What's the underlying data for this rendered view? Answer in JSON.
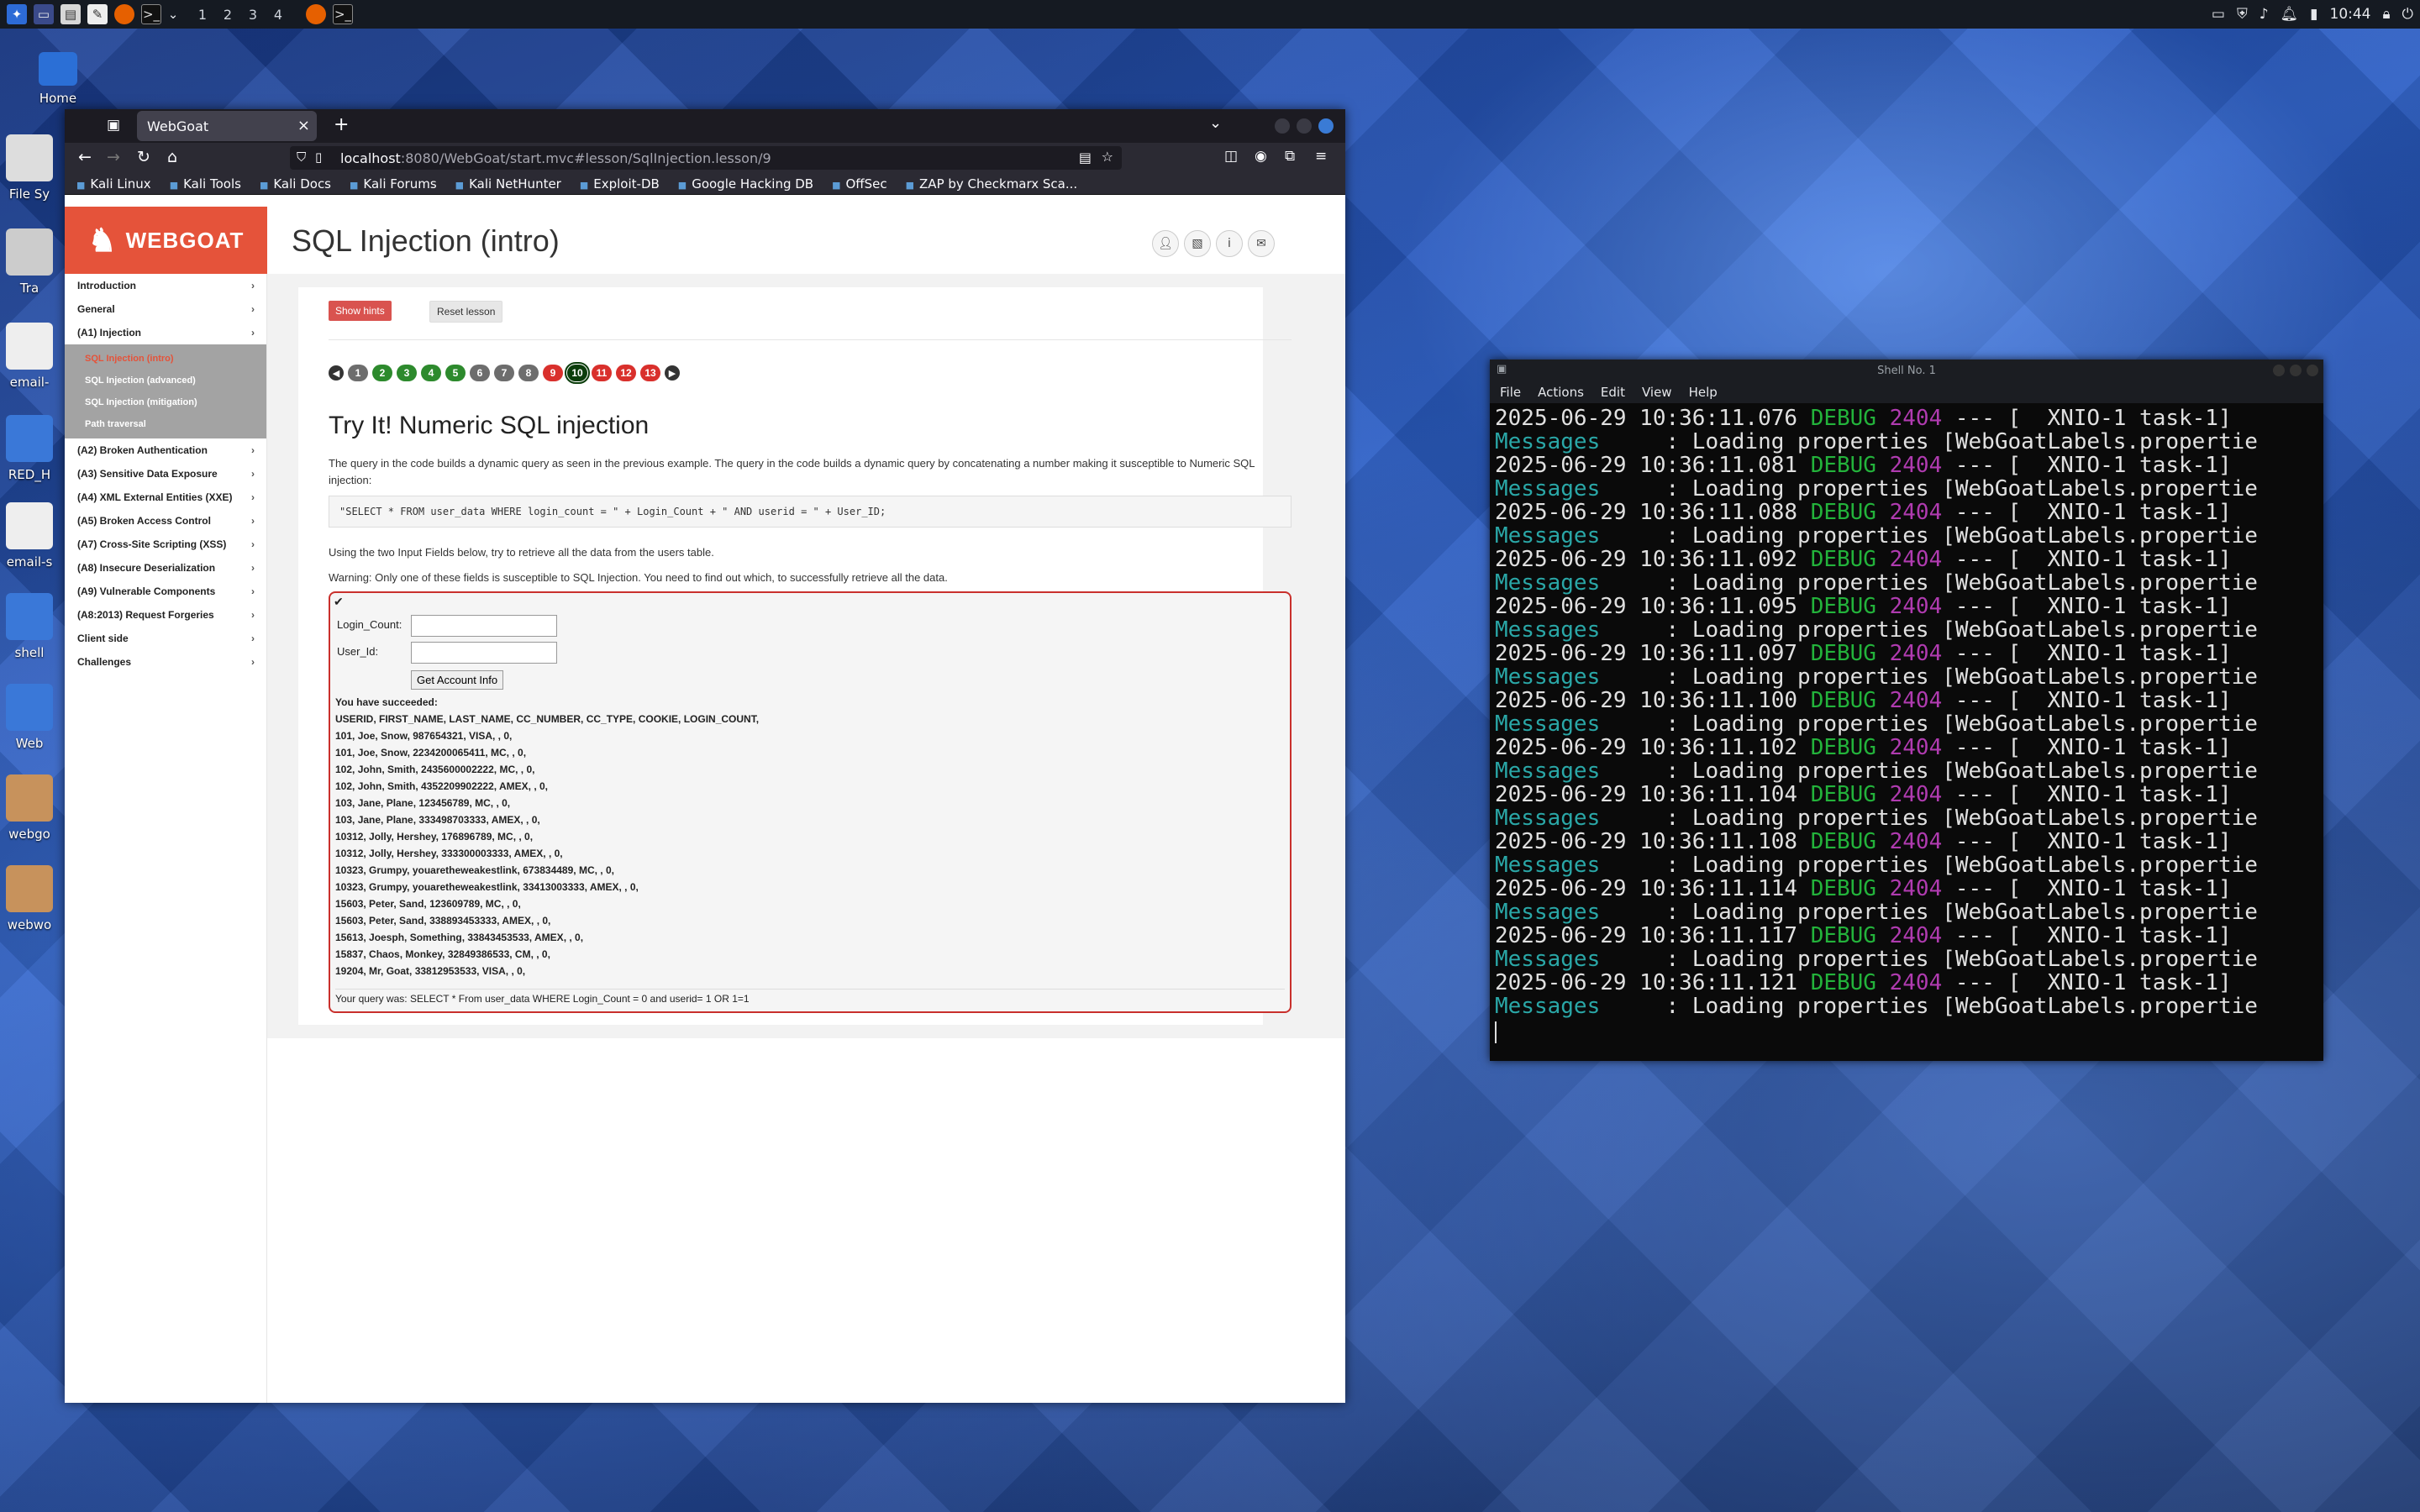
{
  "top_panel": {
    "workspaces": [
      "1",
      "2",
      "3",
      "4"
    ],
    "time": "10:44"
  },
  "desktop_icons": [
    "Home",
    "File Sy",
    "Tra",
    "email-",
    "RED_H",
    "email-s",
    "shell",
    "Web",
    "webgo",
    "webwo"
  ],
  "browser": {
    "tab_title": "WebGoat",
    "url_host": "localhost",
    "url_path": ":8080/WebGoat/start.mvc#lesson/SqlInjection.lesson/9",
    "bookmarks": [
      "Kali Linux",
      "Kali Tools",
      "Kali Docs",
      "Kali Forums",
      "Kali NetHunter",
      "Exploit-DB",
      "Google Hacking DB",
      "OffSec",
      "ZAP by Checkmarx Sca..."
    ]
  },
  "webgoat": {
    "logo": "WEBGOAT",
    "page_title": "SQL Injection (intro)",
    "sidebar": [
      {
        "label": "Introduction"
      },
      {
        "label": "General"
      },
      {
        "label": "(A1) Injection"
      },
      {
        "label": "(A2) Broken Authentication"
      },
      {
        "label": "(A3) Sensitive Data Exposure"
      },
      {
        "label": "(A4) XML External Entities (XXE)"
      },
      {
        "label": "(A5) Broken Access Control"
      },
      {
        "label": "(A7) Cross-Site Scripting (XSS)"
      },
      {
        "label": "(A8) Insecure Deserialization"
      },
      {
        "label": "(A9) Vulnerable Components"
      },
      {
        "label": "(A8:2013) Request Forgeries"
      },
      {
        "label": "Client side"
      },
      {
        "label": "Challenges"
      }
    ],
    "sidebar_sub": [
      "SQL Injection (intro)",
      "SQL Injection (advanced)",
      "SQL Injection (mitigation)",
      "Path traversal"
    ],
    "show_hints": "Show hints",
    "reset_lesson": "Reset lesson",
    "pages": [
      "1",
      "2",
      "3",
      "4",
      "5",
      "6",
      "7",
      "8",
      "9",
      "10",
      "11",
      "12",
      "13"
    ],
    "pages_status": [
      "na",
      "ok",
      "ok",
      "ok",
      "ok",
      "na",
      "na",
      "na",
      "bad",
      "cur",
      "bad",
      "bad",
      "bad"
    ],
    "lesson_heading": "Try It! Numeric SQL injection",
    "lesson_p1": "The query in the code builds a dynamic query as seen in the previous example. The query in the code builds a dynamic query by concatenating a number making it susceptible to Numeric SQL injection:",
    "code": "\"SELECT * FROM user_data WHERE login_count = \" + Login_Count + \" AND userid = \"  + User_ID;",
    "lesson_p2": "Using the two Input Fields below, try to retrieve all the data from the users table.",
    "lesson_p3": "Warning: Only one of these fields is susceptible to SQL Injection. You need to find out which, to successfully retrieve all the data.",
    "login_count_label": "Login_Count:",
    "user_id_label": "User_Id:",
    "get_button": "Get Account Info",
    "success": "You have succeeded:",
    "result_header": "USERID, FIRST_NAME, LAST_NAME, CC_NUMBER, CC_TYPE, COOKIE, LOGIN_COUNT,",
    "rows": [
      "101, Joe, Snow, 987654321, VISA, , 0,",
      "101, Joe, Snow, 2234200065411, MC, , 0,",
      "102, John, Smith, 2435600002222, MC, , 0,",
      "102, John, Smith, 4352209902222, AMEX, , 0,",
      "103, Jane, Plane, 123456789, MC, , 0,",
      "103, Jane, Plane, 333498703333, AMEX, , 0,",
      "10312, Jolly, Hershey, 176896789, MC, , 0,",
      "10312, Jolly, Hershey, 333300003333, AMEX, , 0,",
      "10323, Grumpy, youaretheweakestlink, 673834489, MC, , 0,",
      "10323, Grumpy, youaretheweakestlink, 33413003333, AMEX, , 0,",
      "15603, Peter, Sand, 123609789, MC, , 0,",
      "15603, Peter, Sand, 338893453333, AMEX, , 0,",
      "15613, Joesph, Something, 33843453533, AMEX, , 0,",
      "15837, Chaos, Monkey, 32849386533, CM, , 0,",
      "19204, Mr, Goat, 33812953533, VISA, , 0,"
    ],
    "query_line": "Your query was: SELECT * From user_data WHERE Login_Count = 0 and userid= 1 OR 1=1"
  },
  "terminal": {
    "title": "Shell No. 1",
    "menu": [
      "File",
      "Actions",
      "Edit",
      "View",
      "Help"
    ],
    "log_times": [
      "10:36:11.076",
      "10:36:11.081",
      "10:36:11.088",
      "10:36:11.092",
      "10:36:11.095",
      "10:36:11.097",
      "10:36:11.100",
      "10:36:11.102",
      "10:36:11.104",
      "10:36:11.108",
      "10:36:11.114",
      "10:36:11.117",
      "10:36:11.121"
    ],
    "log_date": "2025-06-29",
    "log_level": "DEBUG",
    "log_pid": "2404",
    "log_thread": "--- [  XNIO-1 task-1]",
    "log_logger": "Messages",
    "log_message": "     : Loading properties [WebGoatLabels.propertie"
  }
}
